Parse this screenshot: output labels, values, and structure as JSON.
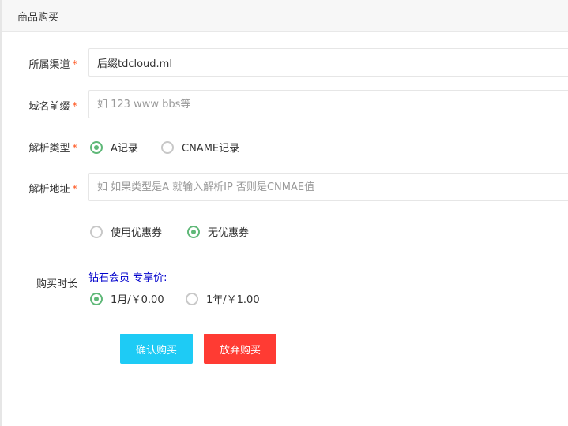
{
  "panel": {
    "title": "商品购买"
  },
  "form": {
    "channel": {
      "label": "所属渠道",
      "required_mark": "*",
      "value": "后缀tdcloud.ml"
    },
    "prefix": {
      "label": "域名前缀",
      "required_mark": "*",
      "placeholder": "如 123 www bbs等"
    },
    "record_type": {
      "label": "解析类型",
      "required_mark": "*",
      "options": [
        {
          "label": "A记录",
          "checked": true
        },
        {
          "label": "CNAME记录",
          "checked": false
        }
      ]
    },
    "address": {
      "label": "解析地址",
      "required_mark": "*",
      "placeholder": "如 如果类型是A 就输入解析IP 否则是CNMAE值"
    },
    "coupon": {
      "options": [
        {
          "label": "使用优惠券",
          "checked": false
        },
        {
          "label": "无优惠券",
          "checked": true
        }
      ]
    },
    "duration": {
      "label": "购买时长",
      "vip_text": "钻石会员 专享价:",
      "options": [
        {
          "label": "1月/￥0.00",
          "checked": true
        },
        {
          "label": "1年/￥1.00",
          "checked": false
        }
      ]
    }
  },
  "buttons": {
    "confirm": "确认购买",
    "abandon": "放弃购买"
  },
  "colors": {
    "accent_green": "#5fb878",
    "confirm_bg": "#1ecbf5",
    "abandon_bg": "#ff3b33",
    "required_mark": "#ff5722",
    "vip_text": "#0000cc"
  }
}
